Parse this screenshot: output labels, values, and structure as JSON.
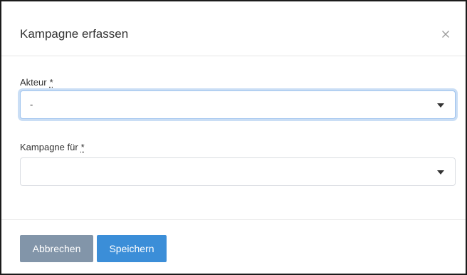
{
  "dialog": {
    "title": "Kampagne erfassen"
  },
  "form": {
    "akteur": {
      "label": "Akteur",
      "required_marker": "*",
      "selected_value": "-"
    },
    "kampagne_fuer": {
      "label": "Kampagne für",
      "required_marker": "*",
      "selected_value": ""
    }
  },
  "footer": {
    "cancel_label": "Abbrechen",
    "save_label": "Speichern"
  },
  "icons": {
    "close": "close-icon",
    "dropdown": "caret-down-icon"
  },
  "colors": {
    "cancel_button": "#8295a9",
    "save_button": "#3b8ed8",
    "focus_ring": "#9fc3ee"
  }
}
